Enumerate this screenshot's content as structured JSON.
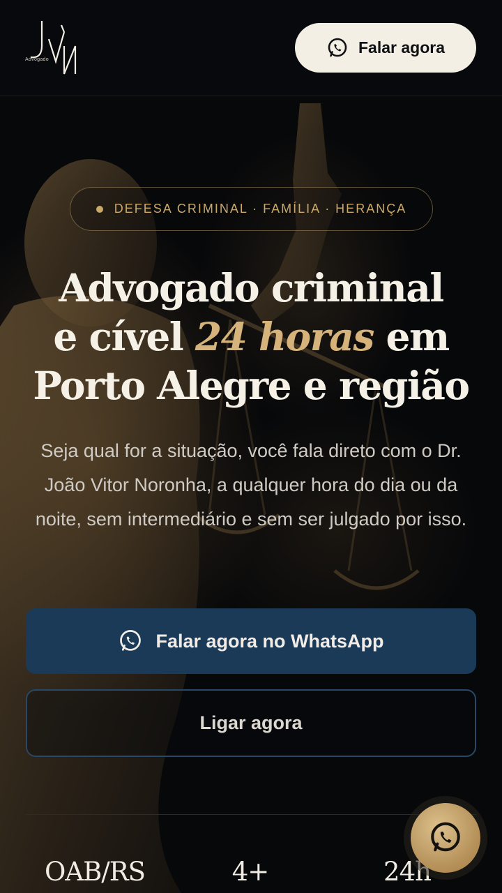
{
  "header": {
    "logo_caption": "Advogado",
    "cta_label": "Falar agora"
  },
  "hero": {
    "tag": "DEFESA CRIMINAL · FAMÍLIA · HERANÇA",
    "title_line1": "Advogado criminal",
    "title_line2_pre": "e cível ",
    "title_line2_accent": "24 horas",
    "title_line2_post": " em",
    "title_line3": "Porto Alegre e região",
    "subtitle": "Seja qual for a situação, você fala direto com o Dr. João Vitor Noronha, a qualquer hora do dia ou da noite, sem intermediário e sem ser julgado por isso.",
    "primary_button": "Falar agora no WhatsApp",
    "secondary_button": "Ligar agora"
  },
  "stats": [
    {
      "value": "OAB/RS"
    },
    {
      "value": "4+"
    },
    {
      "value": "24h"
    }
  ],
  "icons": {
    "header_cta": "whatsapp-icon",
    "primary_button": "whatsapp-icon",
    "floating_button": "whatsapp-icon"
  },
  "colors": {
    "background": "#07080a",
    "accent_gold": "#c9a86a",
    "primary_button": "#1b3a58",
    "header_button": "#f4efe5"
  }
}
